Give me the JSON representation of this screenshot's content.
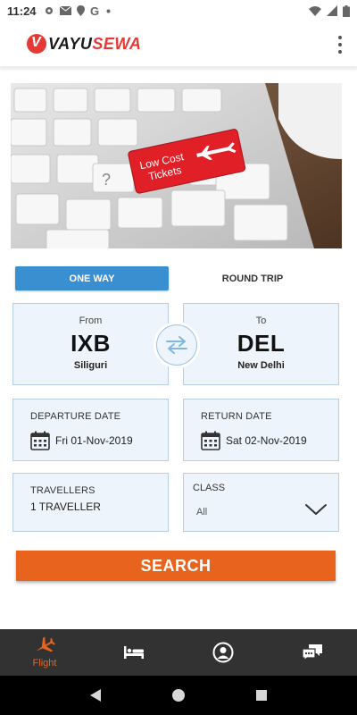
{
  "status_bar": {
    "time": "11:24"
  },
  "app": {
    "logo_part1": "VAYU",
    "logo_part2": "SEWA"
  },
  "banner": {
    "key_line1": "Low Cost",
    "key_line2": "Tickets",
    "key_question": "?"
  },
  "trip_type": {
    "one_way": "ONE WAY",
    "round_trip": "ROUND TRIP",
    "selected": "ONE WAY"
  },
  "from": {
    "label": "From",
    "code": "IXB",
    "city": "Siliguri"
  },
  "to": {
    "label": "To",
    "code": "DEL",
    "city": "New Delhi"
  },
  "departure": {
    "label": "DEPARTURE DATE",
    "value": "Fri 01-Nov-2019"
  },
  "return": {
    "label": "RETURN DATE",
    "value": "Sat 02-Nov-2019"
  },
  "travellers": {
    "label": "TRAVELLERS",
    "value": "1 TRAVELLER"
  },
  "class": {
    "label": "CLASS",
    "value": "All"
  },
  "search": {
    "label": "SEARCH"
  },
  "bottom_nav": [
    {
      "label": "Flight",
      "icon": "airplane-icon",
      "active": true
    },
    {
      "label": "",
      "icon": "hotel-bed-icon",
      "active": false
    },
    {
      "label": "",
      "icon": "account-icon",
      "active": false
    },
    {
      "label": "",
      "icon": "chat-icon",
      "active": false
    }
  ],
  "colors": {
    "accent_blue": "#3a8fd0",
    "accent_orange": "#e8641e",
    "brand_red": "#e53935",
    "field_bg": "#eef4fb",
    "nav_bg": "#323232"
  }
}
